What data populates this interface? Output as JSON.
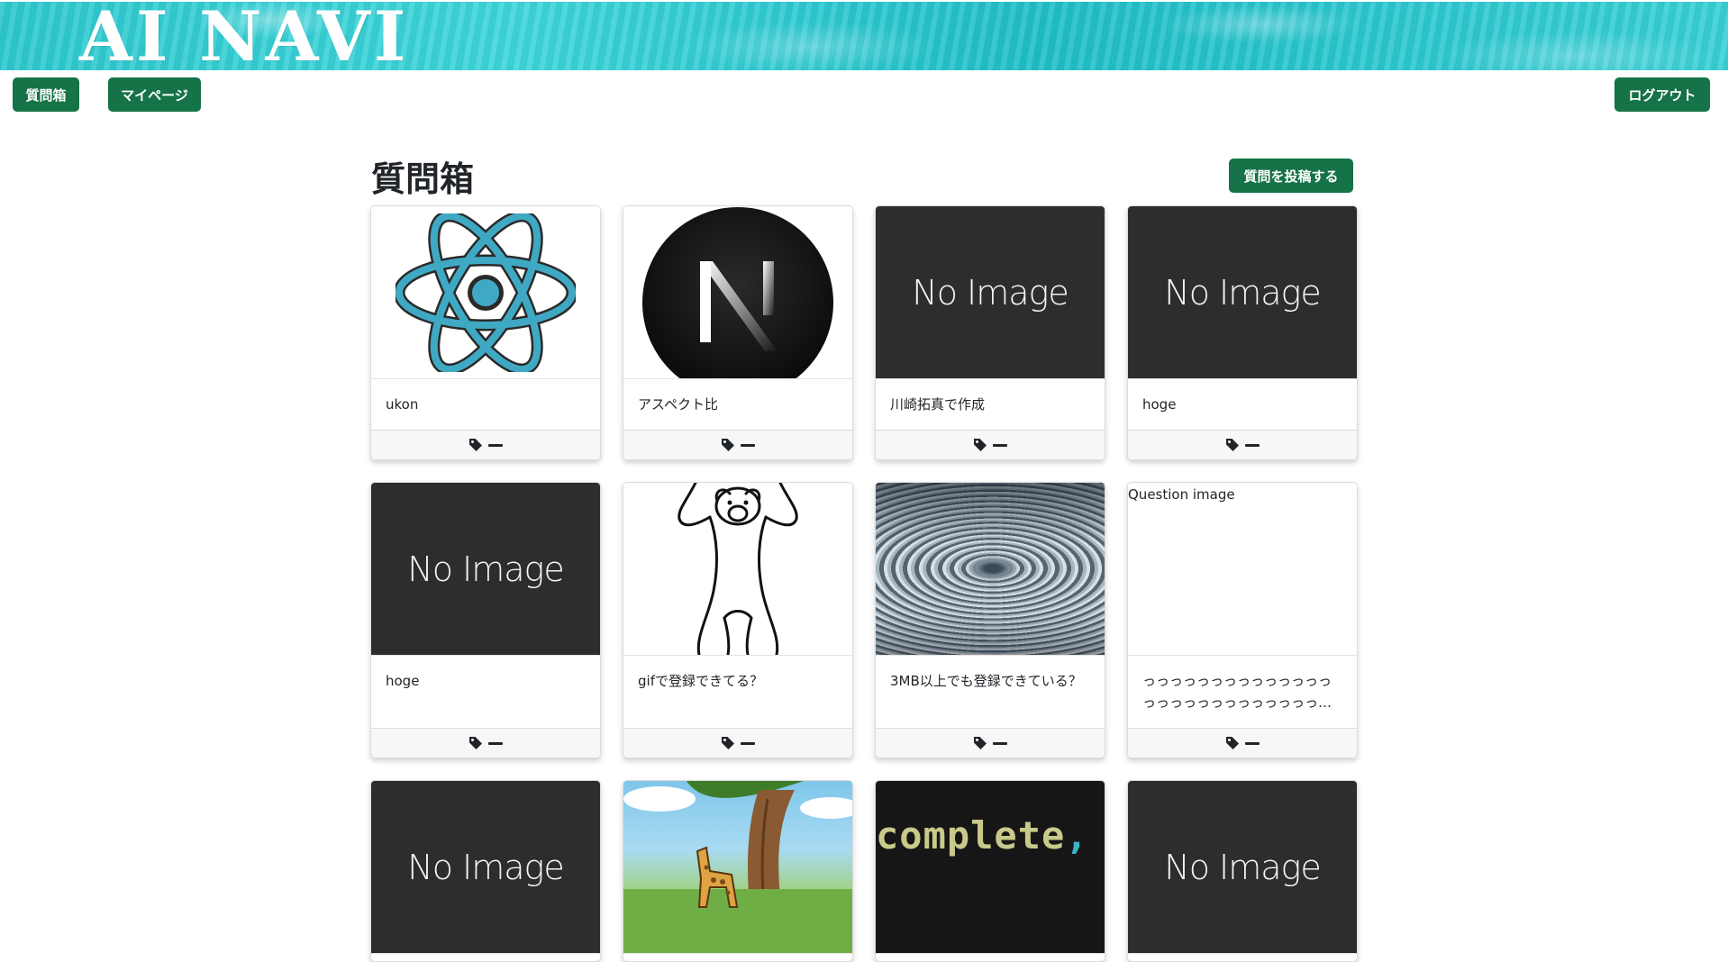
{
  "banner": {
    "title": "AI NAVI"
  },
  "nav": {
    "question_box": "質問箱",
    "my_page": "マイページ",
    "logout": "ログアウト"
  },
  "main": {
    "title": "質問箱",
    "post_button": "質問を投稿する"
  },
  "placeholder": {
    "no_image_text": "No Image"
  },
  "cards": [
    {
      "title": "ukon",
      "image": "react-logo",
      "tag": "—"
    },
    {
      "title": "アスペクト比",
      "image": "nextjs-logo",
      "tag": "—"
    },
    {
      "title": "川崎拓真で作成",
      "image": "no-image",
      "tag": "—"
    },
    {
      "title": "hoge",
      "image": "no-image",
      "tag": "—"
    },
    {
      "title": "hoge",
      "image": "no-image",
      "tag": "—"
    },
    {
      "title": "gifで登録できてる？",
      "image": "bear-drawing",
      "tag": "—"
    },
    {
      "title": "3MB以上でも登録できている？",
      "image": "water-ripples-photo",
      "tag": "—"
    },
    {
      "title": "っっっっっっっっっっっっっっっっっっっっっっっっっっっっ…",
      "image": "broken",
      "alt": "Question image",
      "tag": "—"
    },
    {
      "image": "no-image"
    },
    {
      "image": "giraffe-illustration"
    },
    {
      "image": "code-screenshot",
      "image_text": "complete",
      "image_text_accent": ","
    },
    {
      "image": "no-image"
    }
  ],
  "colors": {
    "primary_button": "#157347",
    "no_image_bg": "#2d2d2d",
    "banner_accent": "#2ec9cf"
  }
}
